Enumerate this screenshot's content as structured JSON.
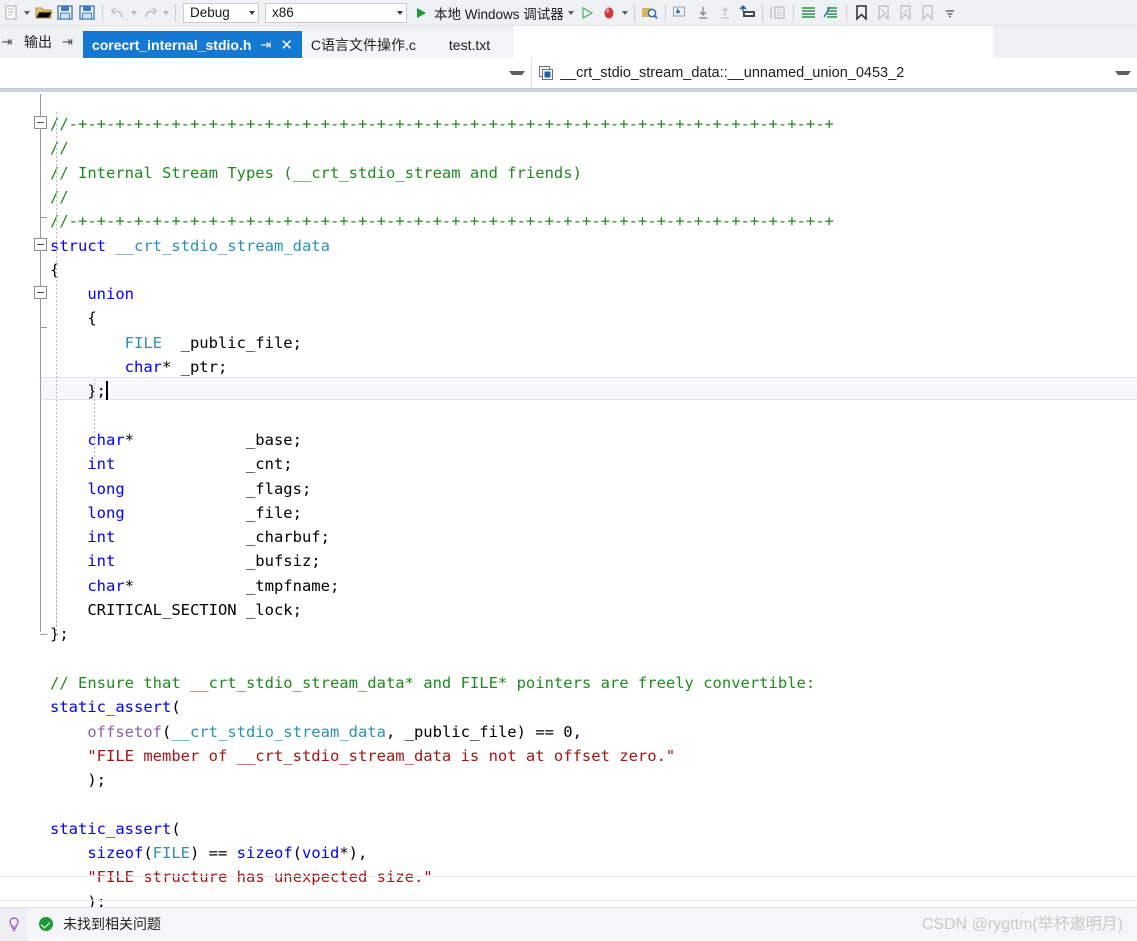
{
  "toolbar": {
    "icons": [
      {
        "name": "new-item-icon",
        "glyph": "new"
      },
      {
        "name": "open-file-icon",
        "glyph": "folder"
      },
      {
        "name": "save-icon",
        "glyph": "save"
      },
      {
        "name": "save-all-icon",
        "glyph": "save-all"
      },
      {
        "name": "undo-icon",
        "glyph": "undo"
      },
      {
        "name": "redo-icon",
        "glyph": "redo"
      }
    ],
    "config_combo": "Debug",
    "platform_combo": "x86",
    "run_label": "本地 Windows 调试器",
    "right_icons": [
      {
        "name": "start-without-debugging-icon",
        "glyph": "play-outline"
      },
      {
        "name": "stop-icon",
        "glyph": "stop-red"
      },
      {
        "name": "find-icon",
        "glyph": "find"
      },
      {
        "name": "step-into-icon",
        "glyph": "step-into"
      },
      {
        "name": "step-over-icon",
        "glyph": "step-over"
      },
      {
        "name": "step-out-icon",
        "glyph": "step-out"
      },
      {
        "name": "comment-icon",
        "glyph": "comment"
      },
      {
        "name": "uncomment-icon",
        "glyph": "uncomment"
      },
      {
        "name": "toggle-bookmark-icon",
        "glyph": "bookmark"
      },
      {
        "name": "prev-bookmark-icon",
        "glyph": "bookmark-prev"
      },
      {
        "name": "next-bookmark-icon",
        "glyph": "bookmark-next"
      },
      {
        "name": "clear-bookmarks-icon",
        "glyph": "bookmark-clear"
      },
      {
        "name": "toolbar-overflow-icon",
        "glyph": "overflow"
      }
    ]
  },
  "tabs": {
    "tool_window": {
      "label": "输出",
      "pin": "⇥"
    },
    "documents": [
      {
        "label": "corecrt_internal_stdio.h",
        "active": true,
        "pin": "⇥",
        "close": "✕"
      },
      {
        "label": "C语言文件操作.c",
        "active": false
      },
      {
        "label": "test.txt",
        "active": false
      }
    ]
  },
  "navbar": {
    "left_value": "",
    "right_value": "__crt_stdio_stream_data::__unnamed_union_0453_2",
    "right_icon": "union-symbol-icon"
  },
  "code": {
    "lines": [
      {
        "indent": 0,
        "fold": true,
        "tokens": [
          {
            "t": "//-+-+-+-+-+-+-+-+-+-+-+-+-+-+-+-+-+-+-+-+-+-+-+-+-+-+-+-+-+-+-+-+-+-+-+-+-+-+-+-+-+",
            "c": "c-comment"
          }
        ]
      },
      {
        "indent": 0,
        "fold": false,
        "tokens": [
          {
            "t": "//",
            "c": "c-comment"
          }
        ]
      },
      {
        "indent": 0,
        "fold": false,
        "tokens": [
          {
            "t": "// Internal Stream Types (__crt_stdio_stream and friends)",
            "c": "c-comment"
          }
        ]
      },
      {
        "indent": 0,
        "fold": false,
        "tokens": [
          {
            "t": "//",
            "c": "c-comment"
          }
        ]
      },
      {
        "indent": 0,
        "fold": false,
        "tokens": [
          {
            "t": "//-+-+-+-+-+-+-+-+-+-+-+-+-+-+-+-+-+-+-+-+-+-+-+-+-+-+-+-+-+-+-+-+-+-+-+-+-+-+-+-+-+",
            "c": "c-comment"
          }
        ]
      },
      {
        "indent": 0,
        "fold": true,
        "tokens": [
          {
            "t": "struct",
            "c": "c-keyword"
          },
          {
            "t": " ",
            "c": "c-plain"
          },
          {
            "t": "__crt_stdio_stream_data",
            "c": "c-type"
          }
        ]
      },
      {
        "indent": 0,
        "fold": false,
        "tokens": [
          {
            "t": "{",
            "c": "c-plain"
          }
        ]
      },
      {
        "indent": 0,
        "fold": true,
        "tokens": [
          {
            "t": "    ",
            "c": "c-plain"
          },
          {
            "t": "union",
            "c": "c-keyword"
          }
        ]
      },
      {
        "indent": 0,
        "fold": false,
        "tokens": [
          {
            "t": "    {",
            "c": "c-plain"
          }
        ]
      },
      {
        "indent": 0,
        "fold": false,
        "tokens": [
          {
            "t": "        ",
            "c": "c-plain"
          },
          {
            "t": "FILE",
            "c": "c-type"
          },
          {
            "t": "  _public_file;",
            "c": "c-plain"
          }
        ]
      },
      {
        "indent": 0,
        "fold": false,
        "tokens": [
          {
            "t": "        ",
            "c": "c-plain"
          },
          {
            "t": "char",
            "c": "c-keyword"
          },
          {
            "t": "* _ptr;",
            "c": "c-plain"
          }
        ]
      },
      {
        "indent": 0,
        "fold": false,
        "current": true,
        "tokens": [
          {
            "t": "    };",
            "c": "c-plain"
          }
        ]
      },
      {
        "indent": 0,
        "fold": false,
        "tokens": []
      },
      {
        "indent": 0,
        "fold": false,
        "tokens": [
          {
            "t": "    ",
            "c": "c-plain"
          },
          {
            "t": "char",
            "c": "c-keyword"
          },
          {
            "t": "*            _base;",
            "c": "c-plain"
          }
        ]
      },
      {
        "indent": 0,
        "fold": false,
        "tokens": [
          {
            "t": "    ",
            "c": "c-plain"
          },
          {
            "t": "int",
            "c": "c-keyword"
          },
          {
            "t": "              _cnt;",
            "c": "c-plain"
          }
        ]
      },
      {
        "indent": 0,
        "fold": false,
        "tokens": [
          {
            "t": "    ",
            "c": "c-plain"
          },
          {
            "t": "long",
            "c": "c-keyword"
          },
          {
            "t": "             _flags;",
            "c": "c-plain"
          }
        ]
      },
      {
        "indent": 0,
        "fold": false,
        "tokens": [
          {
            "t": "    ",
            "c": "c-plain"
          },
          {
            "t": "long",
            "c": "c-keyword"
          },
          {
            "t": "             _file;",
            "c": "c-plain"
          }
        ]
      },
      {
        "indent": 0,
        "fold": false,
        "tokens": [
          {
            "t": "    ",
            "c": "c-plain"
          },
          {
            "t": "int",
            "c": "c-keyword"
          },
          {
            "t": "              _charbuf;",
            "c": "c-plain"
          }
        ]
      },
      {
        "indent": 0,
        "fold": false,
        "tokens": [
          {
            "t": "    ",
            "c": "c-plain"
          },
          {
            "t": "int",
            "c": "c-keyword"
          },
          {
            "t": "              _bufsiz;",
            "c": "c-plain"
          }
        ]
      },
      {
        "indent": 0,
        "fold": false,
        "tokens": [
          {
            "t": "    ",
            "c": "c-plain"
          },
          {
            "t": "char",
            "c": "c-keyword"
          },
          {
            "t": "*            _tmpfname;",
            "c": "c-plain"
          }
        ]
      },
      {
        "indent": 0,
        "fold": false,
        "tokens": [
          {
            "t": "    CRITICAL_SECTION _lock;",
            "c": "c-plain"
          }
        ]
      },
      {
        "indent": 0,
        "fold": false,
        "tokens": [
          {
            "t": "};",
            "c": "c-plain"
          }
        ]
      },
      {
        "indent": 0,
        "fold": false,
        "tokens": []
      },
      {
        "indent": 0,
        "fold": false,
        "tokens": [
          {
            "t": "// Ensure that __crt_stdio_stream_data* and FILE* pointers are freely convertible:",
            "c": "c-comment"
          }
        ]
      },
      {
        "indent": 0,
        "fold": false,
        "tokens": [
          {
            "t": "static_assert",
            "c": "c-keyword"
          },
          {
            "t": "(",
            "c": "c-plain"
          }
        ]
      },
      {
        "indent": 0,
        "fold": false,
        "tokens": [
          {
            "t": "    ",
            "c": "c-plain"
          },
          {
            "t": "offsetof",
            "c": "c-func"
          },
          {
            "t": "(",
            "c": "c-plain"
          },
          {
            "t": "__crt_stdio_stream_data",
            "c": "c-type"
          },
          {
            "t": ", _public_file) == 0,",
            "c": "c-plain"
          }
        ]
      },
      {
        "indent": 0,
        "fold": false,
        "tokens": [
          {
            "t": "    \"FILE member of __crt_stdio_stream_data is not at offset zero.\"",
            "c": "c-string"
          }
        ]
      },
      {
        "indent": 0,
        "fold": false,
        "tokens": [
          {
            "t": "    );",
            "c": "c-plain"
          }
        ]
      },
      {
        "indent": 0,
        "fold": false,
        "tokens": []
      },
      {
        "indent": 0,
        "fold": false,
        "tokens": [
          {
            "t": "static_assert",
            "c": "c-keyword"
          },
          {
            "t": "(",
            "c": "c-plain"
          }
        ]
      },
      {
        "indent": 0,
        "fold": false,
        "tokens": [
          {
            "t": "    ",
            "c": "c-plain"
          },
          {
            "t": "sizeof",
            "c": "c-keyword"
          },
          {
            "t": "(",
            "c": "c-plain"
          },
          {
            "t": "FILE",
            "c": "c-type"
          },
          {
            "t": ") == ",
            "c": "c-plain"
          },
          {
            "t": "sizeof",
            "c": "c-keyword"
          },
          {
            "t": "(",
            "c": "c-plain"
          },
          {
            "t": "void",
            "c": "c-keyword"
          },
          {
            "t": "*),",
            "c": "c-plain"
          }
        ]
      },
      {
        "indent": 0,
        "fold": false,
        "tokens": [
          {
            "t": "    \"FILE structure has unexpected size.\"",
            "c": "c-string"
          }
        ]
      },
      {
        "indent": 0,
        "fold": false,
        "tokens": [
          {
            "t": "    );",
            "c": "c-plain"
          }
        ]
      }
    ]
  },
  "statusbar": {
    "message": "未找到相关问题",
    "icon": "success-check-icon"
  },
  "watermark": "CSDN @rygttm(举杯邀明月)",
  "colors": {
    "accent": "#1479d2",
    "comment": "#1f8a1f",
    "keyword": "#0000ff",
    "type": "#2b91af",
    "string": "#a31515",
    "function": "#8f5fa8",
    "success": "#1a9b37",
    "chrome": "#eff1f5"
  }
}
